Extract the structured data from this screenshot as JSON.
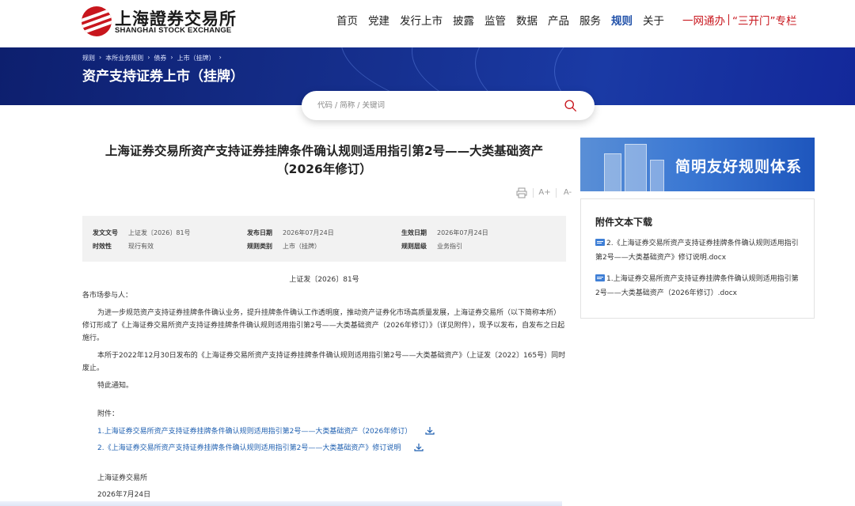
{
  "header": {
    "logo_cn": "上海證券交易所",
    "logo_en": "SHANGHAI STOCK EXCHANGE",
    "nav": [
      "首页",
      "党建",
      "发行上市",
      "披露",
      "监管",
      "数据",
      "产品",
      "服务",
      "规则",
      "关于"
    ],
    "nav_active": "规则",
    "right_links": [
      "一网通办",
      "“三开门”专栏"
    ]
  },
  "banner": {
    "breadcrumb": [
      "规则",
      "本所业务规则",
      "债券",
      "上市（挂牌）"
    ],
    "title": "资产支持证券上市（挂牌）"
  },
  "search": {
    "placeholder": "代码 / 简称 / 关键词"
  },
  "article": {
    "title": "上海证券交易所资产支持证券挂牌条件确认规则适用指引第2号——大类基础资产（2026年修订）",
    "tools": {
      "print": "print-icon",
      "font_larger": "A+",
      "font_smaller": "A-"
    },
    "meta": {
      "doc_no_label": "发文文号",
      "doc_no": "上证发〔2026〕81号",
      "publish_label": "发布日期",
      "publish_date": "2026年07月24日",
      "effective_label": "生效日期",
      "effective_date": "2026年07月24日",
      "status_label": "时效性",
      "status": "现行有效",
      "category_label": "规则类别",
      "category": "上市（挂牌）",
      "level_label": "规则层级",
      "level": "业务指引"
    },
    "doc_number_line": "上证发〔2026〕81号",
    "greeting": "各市场参与人：",
    "para1": "为进一步规范资产支持证券挂牌条件确认业务，提升挂牌条件确认工作透明度，推动资产证券化市场高质量发展，上海证券交易所（以下简称本所）修订形成了《上海证券交易所资产支持证券挂牌条件确认规则适用指引第2号——大类基础资产（2026年修订）》（详见附件），现予以发布，自发布之日起施行。",
    "para2": "本所于2022年12月30日发布的《上海证券交易所资产支持证券挂牌条件确认规则适用指引第2号——大类基础资产》（上证发〔2022〕165号）同时废止。",
    "para3": "特此通知。",
    "attachments_label": "附件：",
    "attachments": [
      "1.上海证券交易所资产支持证券挂牌条件确认规则适用指引第2号——大类基础资产（2026年修订）",
      "2.《上海证券交易所资产支持证券挂牌条件确认规则适用指引第2号——大类基础资产》修订说明"
    ],
    "signature": "上海证券交易所",
    "sign_date": "2026年7月24日"
  },
  "sidebar": {
    "promo_text": "简明友好规则体系",
    "download_title": "附件文本下载",
    "downloads": [
      "2.《上海证券交易所资产支持证券挂牌条件确认规则适用指引第2号——大类基础资产》修订说明.docx",
      "1.上海证券交易所资产支持证券挂牌条件确认规则适用指引第2号——大类基础资产（2026年修订）.docx"
    ]
  },
  "colors": {
    "brand_red": "#c8161d",
    "nav_active": "#1e4fa8",
    "banner": "#16308f",
    "link": "#1e5fb0"
  }
}
